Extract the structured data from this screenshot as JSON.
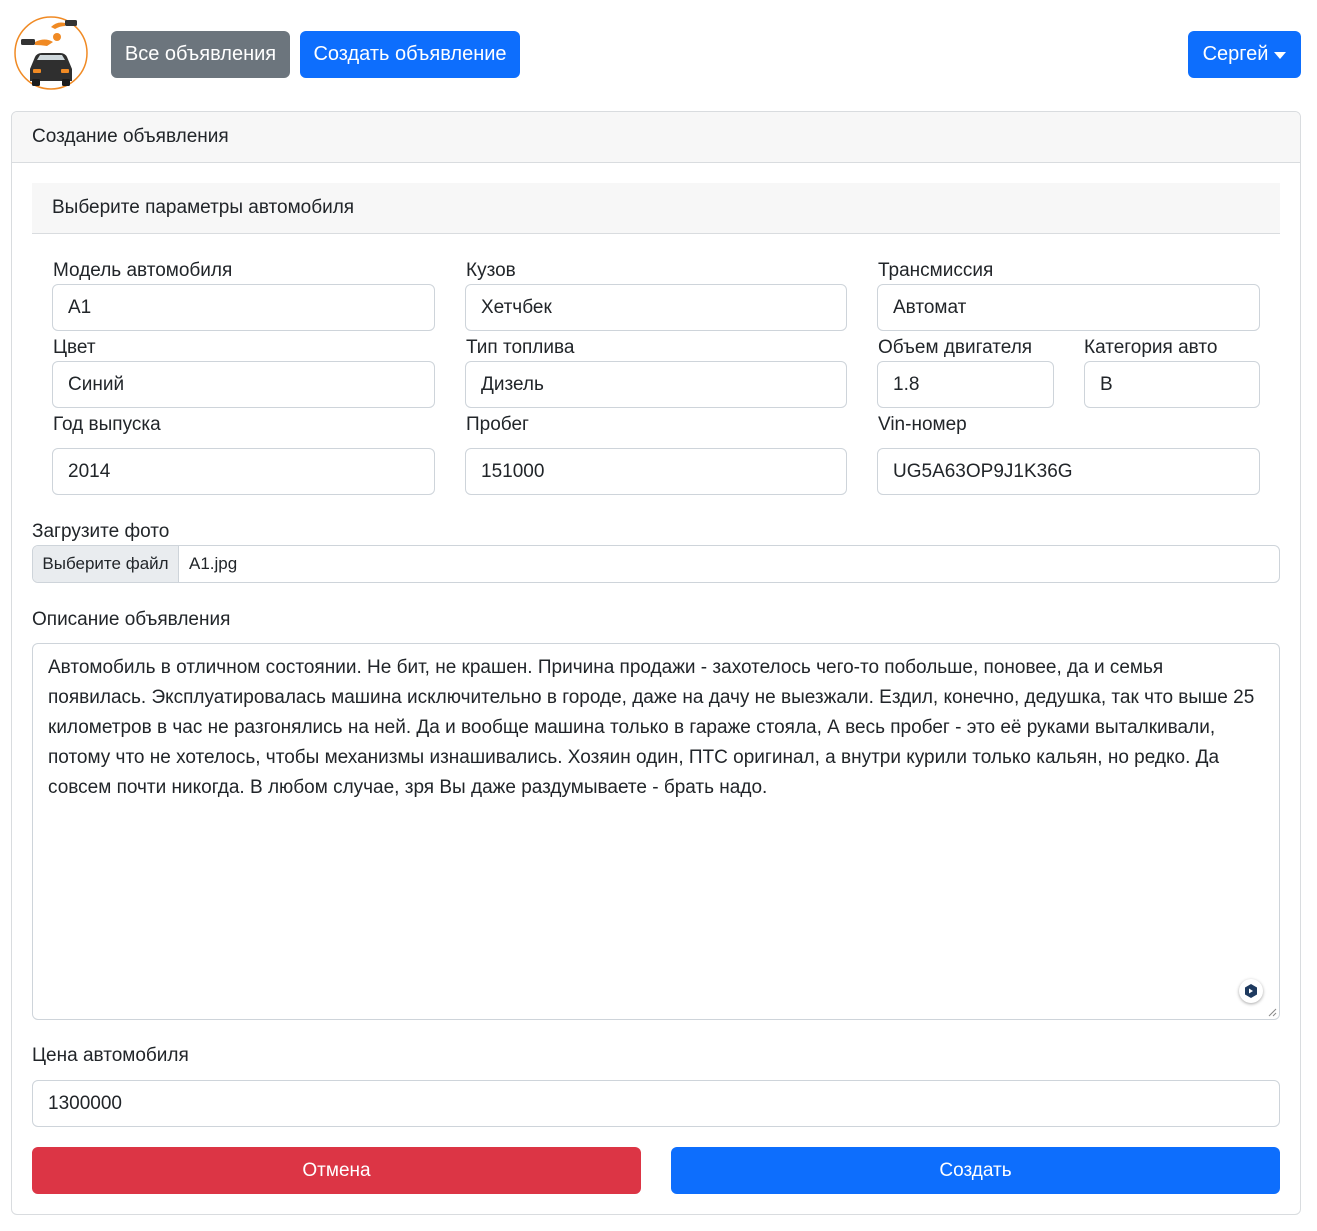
{
  "navbar": {
    "logo_alt": "logo",
    "all_ads_label": "Все объявления",
    "create_ad_label": "Создать объявление",
    "user_label": "Сергей"
  },
  "card": {
    "header": "Создание объявления",
    "section_title": "Выберите параметры автомобиля"
  },
  "fields": {
    "model": {
      "label": "Модель автомобиля",
      "value": "A1"
    },
    "body": {
      "label": "Кузов",
      "value": "Хетчбек"
    },
    "transmission": {
      "label": "Трансмиссия",
      "value": "Автомат"
    },
    "color": {
      "label": "Цвет",
      "value": "Синий"
    },
    "fuel": {
      "label": "Тип топлива",
      "value": "Дизель"
    },
    "engine": {
      "label": "Объем двигателя",
      "value": "1.8"
    },
    "category": {
      "label": "Категория авто",
      "value": "B"
    },
    "year": {
      "label": "Год выпуска",
      "value": "2014"
    },
    "mileage": {
      "label": "Пробег",
      "value": "151000"
    },
    "vin": {
      "label": "Vin-номер",
      "value": "UG5A63OP9J1K36G"
    }
  },
  "photo": {
    "label": "Загрузите фото",
    "button": "Выберите файл",
    "filename": "A1.jpg"
  },
  "description": {
    "label": "Описание объявления",
    "text": "Автомобиль в отличном состоянии. Не бит, не крашен. Причина продажи - захотелось чего-то побольше, поновее, да и семья появилась. Эксплуатировалась машина исключительно в городе, даже на дачу не выезжали. Ездил, конечно, дедушка, так что выше 25 километров в час не разгонялись на ней. Да и вообще машина только в гараже стояла, А весь пробег - это её руками выталкивали, потому что не хотелось, чтобы механизмы изнашивались. Хозяин один, ПТС оригинал, а внутри курили только кальян, но редко. Да совсем почти никогда. В любом случае, зря Вы даже раздумываете - брать надо."
  },
  "price": {
    "label": "Цена автомобиля",
    "value": "1300000"
  },
  "actions": {
    "cancel": "Отмена",
    "submit": "Создать"
  },
  "colors": {
    "primary": "#0d6efd",
    "secondary": "#6c757d",
    "danger": "#dc3545",
    "logo_accent": "#f08a24"
  },
  "icons": [
    "logo-car-icon",
    "chevron-down-icon",
    "grammar-assistant-icon",
    "resize-handle-icon"
  ]
}
